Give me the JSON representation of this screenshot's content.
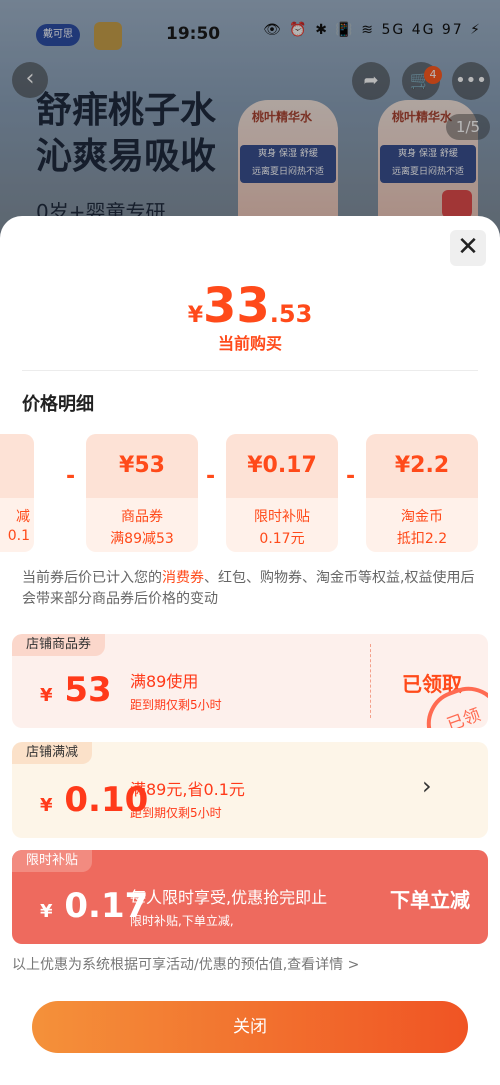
{
  "status_bar": {
    "time": "19:50",
    "icons": "👁 ⏰ ✱ 📳 ≋ 5G 4G 97 ⚡"
  },
  "background": {
    "brand_label": "戴可思",
    "headline_line1": "舒痱桃子水",
    "headline_line2": "沁爽易吸收",
    "subline": "0岁+婴童专研",
    "bottle_label": "桃叶精华水",
    "bottle_band": "爽身 保湿 舒缓\n远离夏日闷热不适",
    "cart_count": "4",
    "page_indicator": "1/5",
    "back_icon": "‹",
    "share_icon": "➦",
    "cart_icon": "🛒",
    "more_icon": "•••"
  },
  "sheet": {
    "close_icon": "✕",
    "price": {
      "currency": "¥",
      "integer": "33",
      "decimal": ".53",
      "caption": "当前购买"
    },
    "section_title": "价格明细",
    "cards": [
      {
        "amount": "¥53",
        "line1": "商品券",
        "line2": "满89减53"
      },
      {
        "amount": "¥0.17",
        "line1": "限时补贴",
        "line2": "0.17元"
      },
      {
        "amount": "¥2.2",
        "line1": "淘金币",
        "line2": "抵扣2.2"
      }
    ],
    "partial_card": {
      "line1": "减",
      "line2": "0.1"
    },
    "minus": "-",
    "note_pre": "当前券后价已计入您的",
    "note_hl": "消费券",
    "note_post": "、红包、购物券、淘金币等权益,权益使用后会带来部分商品券后价格的变动",
    "coupons": [
      {
        "tag": "店铺商品券",
        "yen": "¥",
        "amount": "53",
        "title": "满89使用",
        "sub": "距到期仅剩5小时",
        "action": "已领取",
        "stamp": "已领"
      },
      {
        "tag": "店铺满减",
        "yen": "¥",
        "amount": "0.10",
        "title": "满89元,省0.1元",
        "sub": "距到期仅剩5小时",
        "action": "›"
      },
      {
        "tag": "限时补贴",
        "yen": "¥",
        "amount": "0.17",
        "title": "每人限时享受,优惠抢完即止",
        "sub": "限时补贴,下单立减,",
        "action": "下单立减"
      }
    ],
    "estimate_note": "以上优惠为系统根据可享活动/优惠的预估值,查看详情 >",
    "close_button": "关闭"
  },
  "colors": {
    "accent": "#ff4a1a",
    "button_start": "#f4913a",
    "button_end": "#f05424",
    "subsidy_bg": "#ee6a5e"
  }
}
